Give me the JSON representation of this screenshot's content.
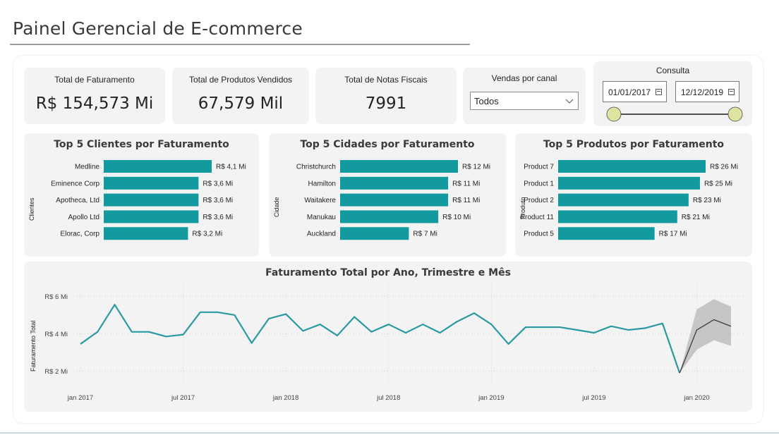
{
  "header": {
    "title": "Painel Gerencial de E-commerce"
  },
  "kpis": [
    {
      "label": "Total de Faturamento",
      "value": "R$ 154,573 Mi"
    },
    {
      "label": "Total de Produtos Vendidos",
      "value": "67,579 Mil"
    },
    {
      "label": "Total de Notas Fiscais",
      "value": "7991"
    }
  ],
  "channel_filter": {
    "label": "Vendas por canal",
    "selected": "Todos"
  },
  "date_filter": {
    "label": "Consulta",
    "start": "01/01/2017",
    "end": "12/12/2019",
    "slider_start": 0.0,
    "slider_end": 1.0
  },
  "colors": {
    "bar": "#139a9e",
    "line": "#2a9aa1",
    "forecast_band": "#bdbdbd",
    "forecast_line": "#3a3a3a",
    "card_bg": "#f3f3f3",
    "slider_handle": "#dfe4a0"
  },
  "chart_data": [
    {
      "type": "bar",
      "title": "Top 5 Clientes por Faturamento",
      "ylabel": "Clientes",
      "categories": [
        "Medline",
        "Eminence Corp",
        "Apotheca, Ltd",
        "Apollo Ltd",
        "Elorac, Corp"
      ],
      "values": [
        4.1,
        3.6,
        3.6,
        3.6,
        3.2
      ],
      "data_labels": [
        "R$ 4,1 Mi",
        "R$ 3,6 Mi",
        "R$ 3,6 Mi",
        "R$ 3,6 Mi",
        "R$ 3,2 Mi"
      ],
      "xlim": [
        0,
        4.1
      ]
    },
    {
      "type": "bar",
      "title": "Top 5 Cidades por Faturamento",
      "ylabel": "Cidade",
      "categories": [
        "Christchurch",
        "Hamilton",
        "Waitakere",
        "Manukau",
        "Auckland"
      ],
      "values": [
        12,
        11,
        11,
        10,
        7
      ],
      "data_labels": [
        "R$ 12 Mi",
        "R$ 11 Mi",
        "R$ 11 Mi",
        "R$ 10 Mi",
        "R$ 7 Mi"
      ],
      "xlim": [
        0,
        12
      ]
    },
    {
      "type": "bar",
      "title": "Top 5 Produtos por Faturamento",
      "ylabel": "Produto",
      "categories": [
        "Product 7",
        "Product 1",
        "Product 2",
        "Product 11",
        "Product 5"
      ],
      "values": [
        26,
        25,
        23,
        21,
        17
      ],
      "data_labels": [
        "R$ 26 Mi",
        "R$ 25 Mi",
        "R$ 23 Mi",
        "R$ 21 Mi",
        "R$ 17 Mi"
      ],
      "xlim": [
        0,
        26
      ]
    },
    {
      "type": "line",
      "title": "Faturamento Total por Ano, Trimestre e Mês",
      "ylabel": "Faturamento Total",
      "yticks": [
        "R$ 2 Mi",
        "R$ 4 Mi",
        "R$ 6 Mi"
      ],
      "ytick_values": [
        2,
        4,
        6
      ],
      "ylim": [
        1.6,
        6.5
      ],
      "xticks": [
        "jan 2017",
        "jul 2017",
        "jan 2018",
        "jul 2018",
        "jan 2019",
        "jul 2019",
        "jan 2020"
      ],
      "xtick_index": [
        0,
        6,
        12,
        18,
        24,
        30,
        36
      ],
      "x_count": 39,
      "grid": true,
      "series": [
        {
          "values": [
            3.45,
            4.1,
            5.55,
            4.1,
            4.1,
            3.85,
            3.95,
            5.15,
            5.15,
            5.0,
            3.5,
            4.8,
            5.05,
            4.15,
            4.5,
            3.9,
            4.9,
            4.1,
            4.5,
            4.05,
            4.5,
            4.05,
            4.65,
            5.1,
            4.5,
            3.45,
            4.35,
            4.35,
            4.35,
            4.2,
            4.05,
            4.4,
            4.2,
            4.3,
            4.55,
            1.9
          ]
        }
      ],
      "forecast": {
        "start_index": 35,
        "values": [
          1.9,
          4.2,
          4.75,
          4.4
        ],
        "upper": [
          1.9,
          5.3,
          5.85,
          5.45
        ],
        "lower": [
          1.9,
          3.15,
          3.65,
          3.35
        ]
      }
    }
  ]
}
